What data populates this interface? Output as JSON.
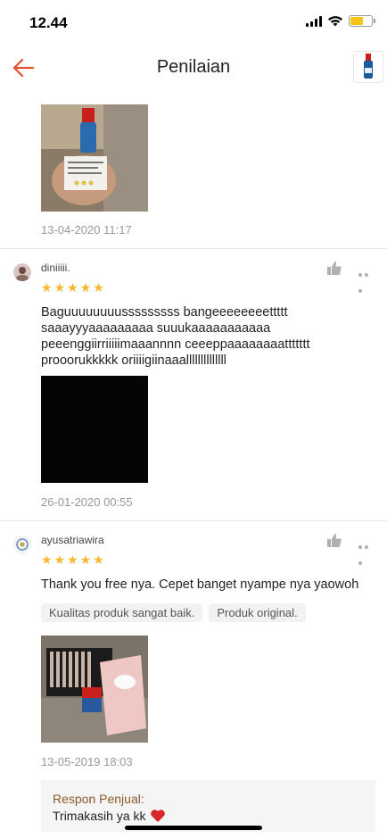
{
  "status_bar": {
    "time": "12.44",
    "battery_level": 0.6,
    "battery_color": "#f5c518"
  },
  "nav": {
    "title": "Penilaian",
    "back_color": "#e4502e"
  },
  "reviews": [
    {
      "date": "13-04-2020 11:17"
    },
    {
      "username": "diniiiii.",
      "rating": 5,
      "text": "Baguuuuuuuusssssssss bangeeeeeeeettttt saaayyyaaaaaaaaa suuukaaaaaaaaaaa peeenggiirriiiiimaaannnn ceeeppaaaaaaaattttttt prooorukkkkk oriiiigiinaaallllllllllllll",
      "date": "26-01-2020 00:55"
    },
    {
      "username": "ayusatriawira",
      "rating": 5,
      "text": "Thank you free nya. Cepet banget nyampe nya yaowoh",
      "tags": [
        "Kualitas produk sangat baik.",
        "Produk original."
      ],
      "date": "13-05-2019 18:03",
      "seller_response": {
        "label": "Respon Penjual:",
        "text": "Trimakasih ya kk"
      }
    }
  ]
}
